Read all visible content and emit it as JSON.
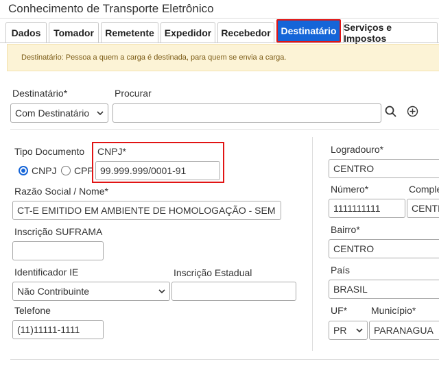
{
  "window_title": "Conhecimento de Transporte Eletrônico",
  "tabs": [
    {
      "label": "Dados"
    },
    {
      "label": "Tomador"
    },
    {
      "label": "Remetente"
    },
    {
      "label": "Expedidor"
    },
    {
      "label": "Recebedor"
    },
    {
      "label": "Destinatário",
      "active": true
    },
    {
      "label": "Serviços e Impostos"
    }
  ],
  "info_message": "Destinatário: Pessoa a quem a carga é destinada, para quem se envia a carga.",
  "destinatario": {
    "label": "Destinatário*",
    "selected": "Com Destinatário",
    "search_label": "Procurar",
    "search_value": ""
  },
  "left_form": {
    "tipo_documento_label": "Tipo Documento",
    "radio_cnpj_label": "CNPJ",
    "radio_cpf_label": "CPF",
    "radio_selected": "CNPJ",
    "cnpj_label": "CNPJ*",
    "cnpj_value": "99.999.999/0001-91",
    "razao_label": "Razão Social / Nome*",
    "razao_value": "CT-E EMITIDO EM AMBIENTE DE HOMOLOGAÇÃO - SEM",
    "suframa_label": "Inscrição SUFRAMA",
    "suframa_value": "",
    "ie_label": "Identificador IE",
    "ie_selected": "Não Contribuinte",
    "inscricao_estadual_label": "Inscrição Estadual",
    "inscricao_estadual_value": "",
    "telefone_label": "Telefone",
    "telefone_value": "(11)11111-1111"
  },
  "right_form": {
    "logradouro_label": "Logradouro*",
    "logradouro_value": "CENTRO",
    "numero_label": "Número*",
    "numero_value": "1111111111",
    "complemento_label": "Comple",
    "complemento_value": "CENTR",
    "bairro_label": "Bairro*",
    "bairro_value": "CENTRO",
    "pais_label": "País",
    "pais_value": "BRASIL",
    "uf_label": "UF*",
    "uf_selected": "PR",
    "municipio_label": "Município*",
    "municipio_value": "PARANAGUA"
  },
  "colors": {
    "active_tab": "#1565d8",
    "highlight": "#e11414",
    "info_bg": "#fcf3d6",
    "info_text": "#7a5a14"
  },
  "icons": [
    "search-icon",
    "add-circle-icon",
    "chevron-down-icon"
  ]
}
